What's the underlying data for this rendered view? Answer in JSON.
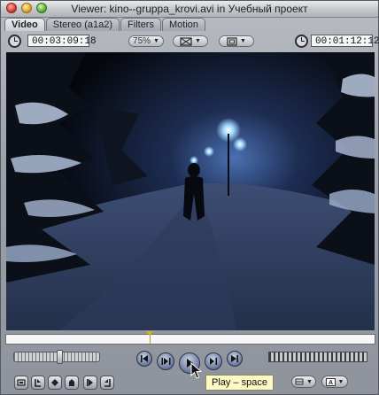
{
  "window": {
    "title": "Viewer: kino--gruppa_krovi.avi in Учебный проект"
  },
  "tabs": [
    {
      "label": "Video",
      "active": true
    },
    {
      "label": "Stereo (a1a2)",
      "active": false
    },
    {
      "label": "Filters",
      "active": false
    },
    {
      "label": "Motion",
      "active": false
    }
  ],
  "controls": {
    "duration_timecode": "00:03:09:18",
    "zoom_label": "75%",
    "current_timecode": "00:01:12:12"
  },
  "playback": {
    "position_fraction": 0.39
  },
  "tooltip": {
    "text": "Play – space"
  },
  "icons": {
    "clock_left": "clock-icon",
    "clock_right": "clock-icon",
    "view_mode": "view-mode-icon",
    "overlay": "overlay-frame-icon",
    "go_to_in": "go-to-in-point-icon",
    "play_in_out": "play-in-to-out-icon",
    "play": "play-icon",
    "play_around": "play-around-icon",
    "go_to_out": "go-to-out-point-icon",
    "match_frame": "match-frame-icon",
    "mark_in": "mark-in-icon",
    "mark_out": "mark-out-icon",
    "add_marker": "add-marker-icon",
    "mark_clip": "mark-clip-icon",
    "add_keyframe": "add-keyframe-icon",
    "marker_dropdown": "marker-menu-icon",
    "generator_dropdown": "generator-menu-icon"
  },
  "colors": {
    "playhead": "#d4b21c",
    "transport_blue": "#6f7da0",
    "tooltip_bg": "#fbf9c4"
  }
}
